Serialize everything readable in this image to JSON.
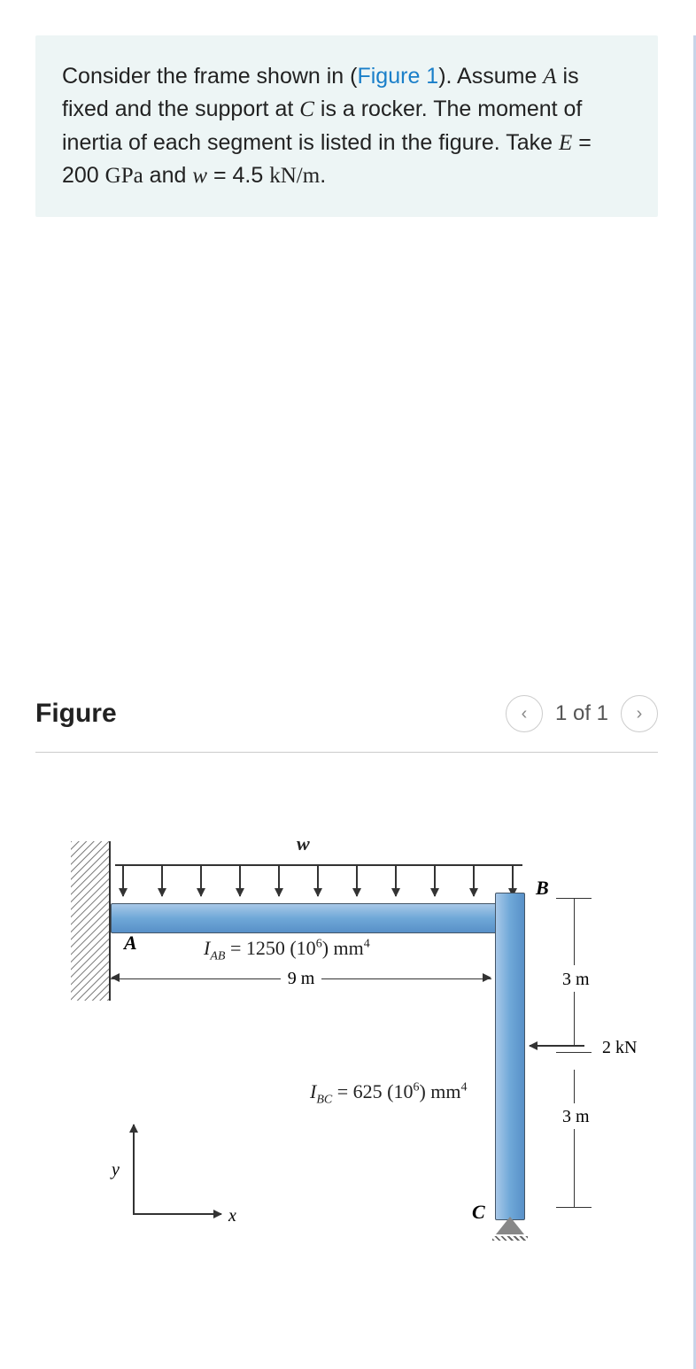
{
  "problem": {
    "prefix": "Consider the frame shown in (",
    "figlink": "Figure 1",
    "after_link": "). Assume ",
    "varA": "A",
    "text2": " is fixed and the support at ",
    "varC": "C",
    "text3": " is a rocker. The moment of inertia of each segment is listed in the figure. Take ",
    "varE": "E",
    "eq1_val": " = 200 ",
    "eq1_unit": "GPa",
    "and": " and ",
    "varw": "w",
    "eq2_val": " = 4.5 ",
    "eq2_unit": "kN/m",
    "period": "."
  },
  "figure_header": {
    "title": "Figure",
    "counter": "1 of 1"
  },
  "figure": {
    "w": "w",
    "A": "A",
    "B": "B",
    "C": "C",
    "Iab": "1250 (10",
    "Iab_exp": "6",
    "Iab_unit": ") mm",
    "Iab_unit_exp": "4",
    "Ibc": "625 (10",
    "Ibc_exp": "6",
    "Ibc_unit": ") mm",
    "Ibc_unit_exp": "4",
    "len9": "9 m",
    "len3a": "3 m",
    "len3b": "3 m",
    "force": "2 kN",
    "y": "y",
    "x": "x"
  }
}
